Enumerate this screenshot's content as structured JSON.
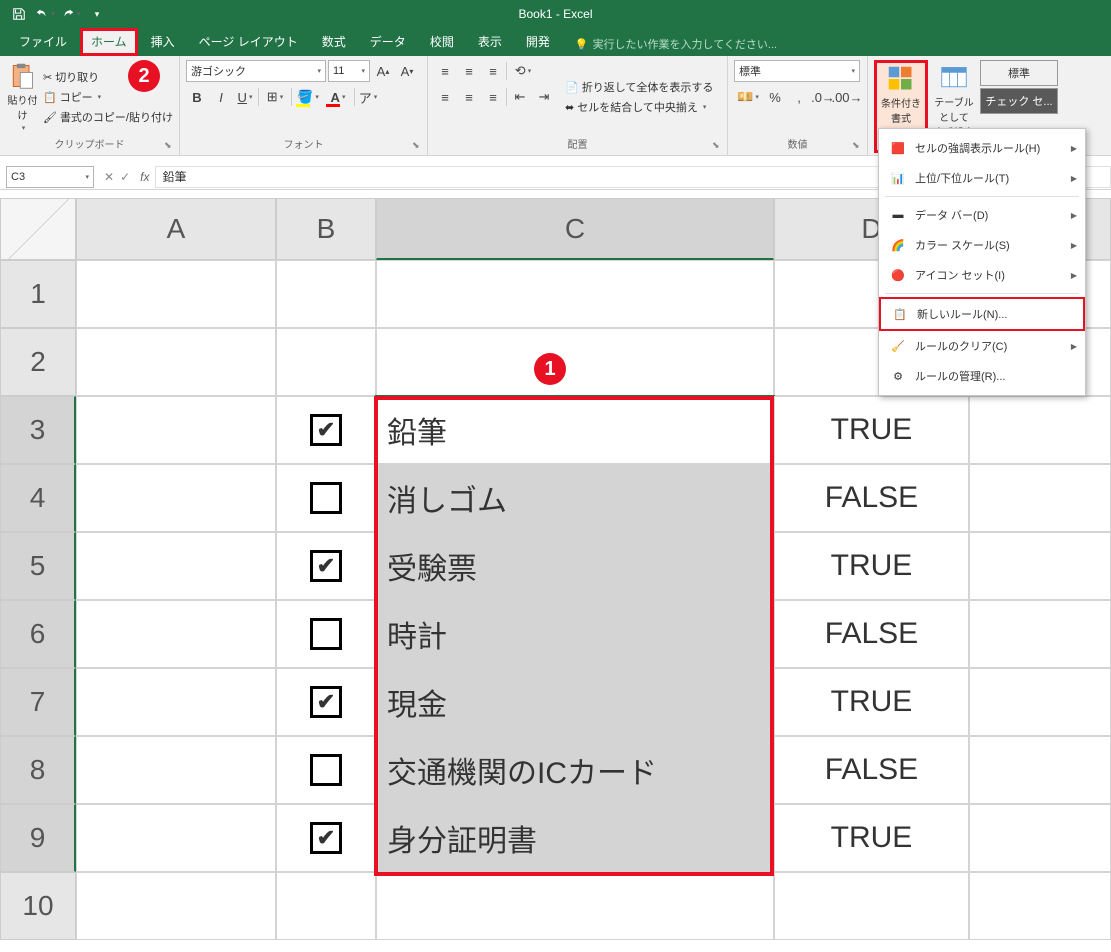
{
  "title": "Book1 - Excel",
  "tabs": {
    "file": "ファイル",
    "home": "ホーム",
    "insert": "挿入",
    "pagelayout": "ページ レイアウト",
    "formulas": "数式",
    "data": "データ",
    "review": "校閲",
    "view": "表示",
    "developer": "開発"
  },
  "tellme": "実行したい作業を入力してください...",
  "clipboard": {
    "label": "クリップボード",
    "cut": "切り取り",
    "copy": "コピー",
    "formatpainter": "書式のコピー/貼り付け",
    "paste": "貼り付け"
  },
  "font": {
    "label": "フォント",
    "name": "游ゴシック",
    "size": "11"
  },
  "alignment": {
    "label": "配置",
    "wrap": "折り返して全体を表示する",
    "merge": "セルを結合して中央揃え"
  },
  "number": {
    "label": "数値",
    "format": "標準"
  },
  "styles": {
    "cf": "条件付き\n書式",
    "table": "テーブルとして\n書式設定",
    "cellstyle": "標準",
    "check": "チェック セ..."
  },
  "cf_menu": {
    "highlight": "セルの強調表示ルール(H)",
    "topbottom": "上位/下位ルール(T)",
    "databar": "データ バー(D)",
    "colorscale": "カラー スケール(S)",
    "iconset": "アイコン セット(I)",
    "newrule": "新しいルール(N)...",
    "clearrules": "ルールのクリア(C)",
    "managerules": "ルールの管理(R)..."
  },
  "namebox": "C3",
  "formula": "鉛筆",
  "columns": [
    "A",
    "B",
    "C",
    "D"
  ],
  "rows": [
    {
      "n": "1",
      "b": "",
      "c": "",
      "d": ""
    },
    {
      "n": "2",
      "b": "",
      "c": "",
      "d": ""
    },
    {
      "n": "3",
      "checked": true,
      "c": "鉛筆",
      "d": "TRUE"
    },
    {
      "n": "4",
      "checked": false,
      "c": "消しゴム",
      "d": "FALSE"
    },
    {
      "n": "5",
      "checked": true,
      "c": "受験票",
      "d": "TRUE"
    },
    {
      "n": "6",
      "checked": false,
      "c": "時計",
      "d": "FALSE"
    },
    {
      "n": "7",
      "checked": true,
      "c": "現金",
      "d": "TRUE"
    },
    {
      "n": "8",
      "checked": false,
      "c": "交通機関のICカード",
      "d": "FALSE"
    },
    {
      "n": "9",
      "checked": true,
      "c": "身分証明書",
      "d": "TRUE"
    },
    {
      "n": "10",
      "b": "",
      "c": "",
      "d": ""
    }
  ],
  "badges": {
    "one": "1",
    "two": "2"
  }
}
